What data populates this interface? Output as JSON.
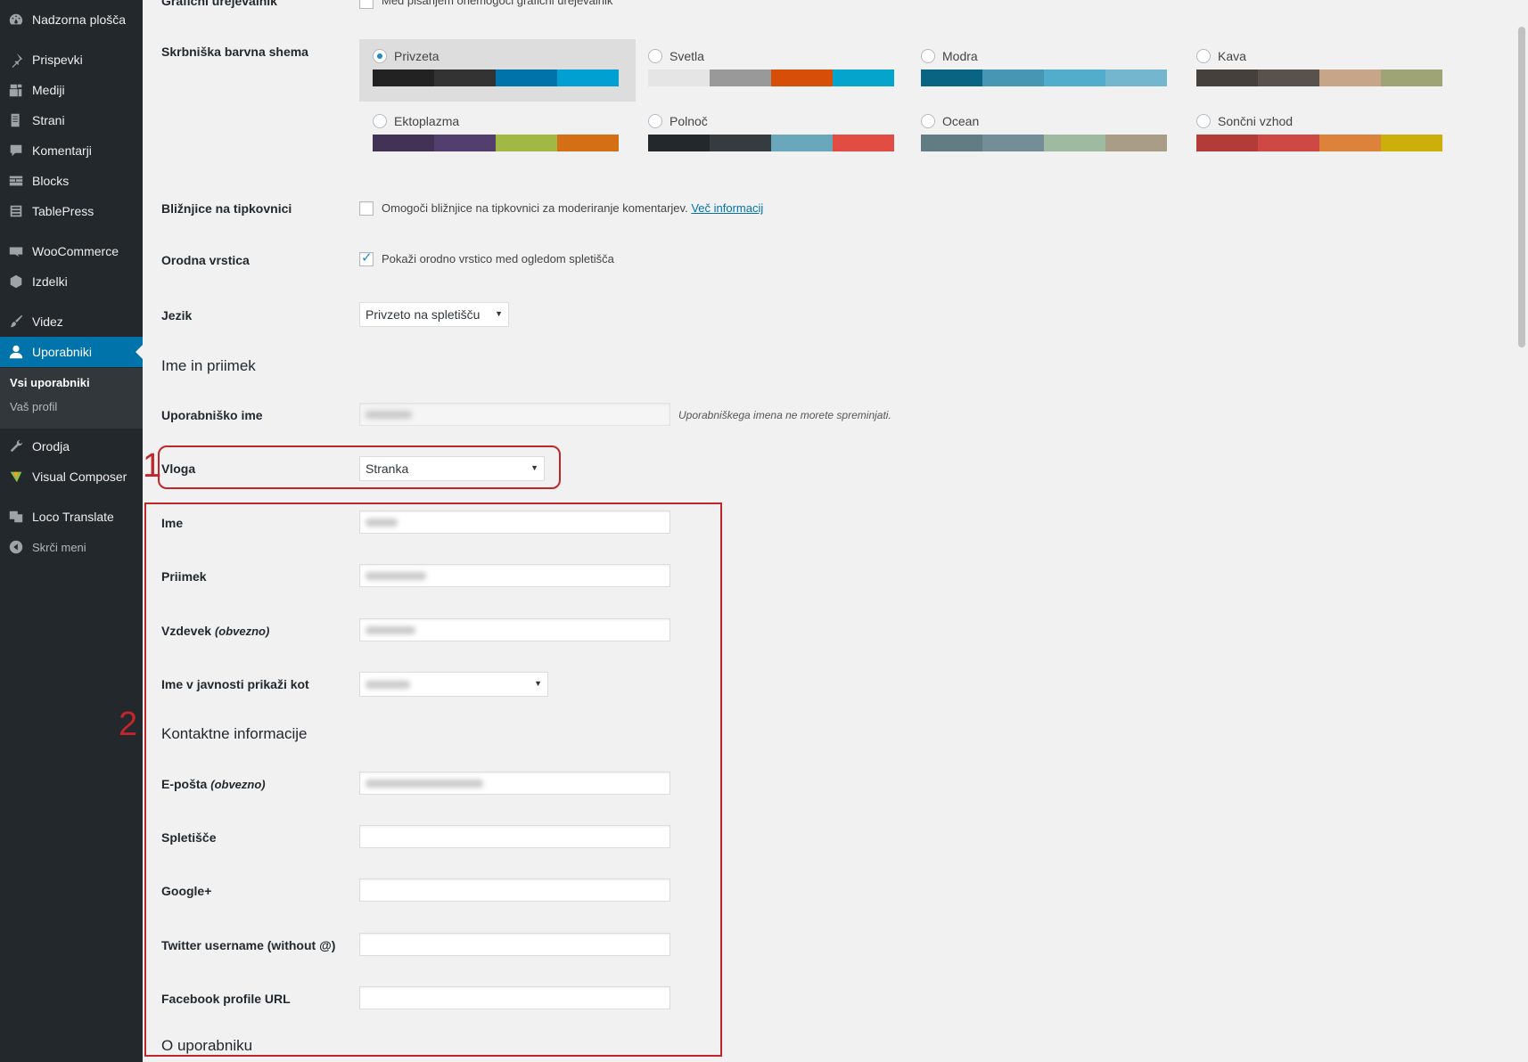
{
  "sidebar": {
    "items": [
      {
        "label": "Nadzorna plošča",
        "icon": "dashboard-icon"
      },
      {
        "label": "Prispevki",
        "icon": "pin-icon"
      },
      {
        "label": "Mediji",
        "icon": "media-icon"
      },
      {
        "label": "Strani",
        "icon": "page-icon"
      },
      {
        "label": "Komentarji",
        "icon": "comment-icon"
      },
      {
        "label": "Blocks",
        "icon": "blocks-icon"
      },
      {
        "label": "TablePress",
        "icon": "table-icon"
      },
      {
        "label": "WooCommerce",
        "icon": "woo-icon"
      },
      {
        "label": "Izdelki",
        "icon": "product-box-icon"
      },
      {
        "label": "Videz",
        "icon": "brush-icon"
      },
      {
        "label": "Uporabniki",
        "icon": "user-icon"
      },
      {
        "label": "Orodja",
        "icon": "wrench-icon"
      },
      {
        "label": "Visual Composer",
        "icon": "visual-composer-icon"
      },
      {
        "label": "Loco Translate",
        "icon": "translate-icon"
      },
      {
        "label": "Skrči meni",
        "icon": "collapse-icon"
      }
    ],
    "submenu": [
      "Vsi uporabniki",
      "Vaš profil"
    ]
  },
  "top_row": {
    "label": "Grafični urejevalnik",
    "checkbox_label": "Med pisanjem onemogoči grafični urejevalnik"
  },
  "color_scheme": {
    "label": "Skrbniška barvna shema",
    "schemes": [
      {
        "name": "Privzeta",
        "selected": true,
        "colors": [
          "#222222",
          "#333333",
          "#0073aa",
          "#00a0d2"
        ]
      },
      {
        "name": "Svetla",
        "selected": false,
        "colors": [
          "#e5e5e5",
          "#999999",
          "#d64e07",
          "#04a4cc"
        ]
      },
      {
        "name": "Modra",
        "selected": false,
        "colors": [
          "#096484",
          "#4796b3",
          "#52accc",
          "#74b6ce"
        ]
      },
      {
        "name": "Kava",
        "selected": false,
        "colors": [
          "#46403c",
          "#59524c",
          "#c7a589",
          "#9ea476"
        ]
      },
      {
        "name": "Ektoplazma",
        "selected": false,
        "colors": [
          "#413256",
          "#523f6d",
          "#a3b745",
          "#d46f15"
        ]
      },
      {
        "name": "Polnoč",
        "selected": false,
        "colors": [
          "#25282b",
          "#363b3f",
          "#69a8bb",
          "#e14d43"
        ]
      },
      {
        "name": "Ocean",
        "selected": false,
        "colors": [
          "#627c83",
          "#738e96",
          "#9ebaa0",
          "#aa9d88"
        ]
      },
      {
        "name": "Sončni vzhod",
        "selected": false,
        "colors": [
          "#b43c38",
          "#cf4944",
          "#dd823b",
          "#ccaf0b"
        ]
      }
    ]
  },
  "shortcuts": {
    "label": "Bližnjice na tipkovnici",
    "checkbox_label": "Omogoči bližnjice na tipkovnici za moderiranje komentarjev.",
    "link": "Več informacij"
  },
  "toolbar": {
    "label": "Orodna vrstica",
    "checkbox_label": "Pokaži orodno vrstico med ogledom spletišča"
  },
  "language": {
    "label": "Jezik",
    "value": "Privzeto na spletišču"
  },
  "name_section": {
    "title": "Ime in priimek"
  },
  "username": {
    "label": "Uporabniško ime",
    "hint": "Uporabniškega imena ne morete spreminjati."
  },
  "role": {
    "label": "Vloga",
    "value": "Stranka"
  },
  "first_name": {
    "label": "Ime"
  },
  "last_name": {
    "label": "Priimek"
  },
  "nickname": {
    "label": "Vzdevek",
    "required": "(obvezno)"
  },
  "display_name": {
    "label": "Ime v javnosti prikaži kot"
  },
  "contact_section": {
    "title": "Kontaktne informacije"
  },
  "email": {
    "label": "E-pošta",
    "required": "(obvezno)"
  },
  "website": {
    "label": "Spletišče"
  },
  "googleplus": {
    "label": "Google+"
  },
  "twitter": {
    "label": "Twitter username (without @)"
  },
  "facebook": {
    "label": "Facebook profile URL"
  },
  "about_section": {
    "title": "O uporabniku"
  },
  "annotations": {
    "one": "1",
    "two": "2"
  },
  "colors": {
    "accent": "#0073aa",
    "annotation": "#c0262c",
    "sidebar_bg": "#23282d"
  }
}
